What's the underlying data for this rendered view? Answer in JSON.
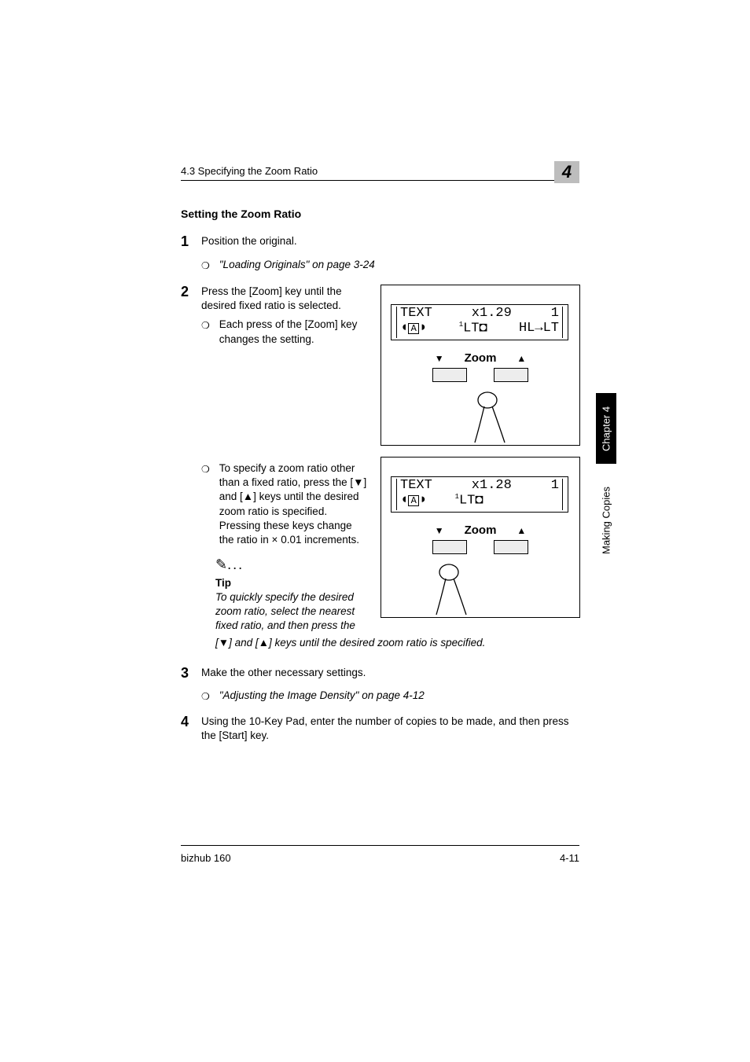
{
  "runningHead": "4.3 Specifying the Zoom Ratio",
  "chapterNum": "4",
  "heading": "Setting the Zoom Ratio",
  "step1": {
    "num": "1",
    "text": "Position the original.",
    "ref": "\"Loading Originals\" on page 3-24"
  },
  "step2": {
    "num": "2",
    "text": "Press the [Zoom] key until the desired fixed ratio is selected.",
    "sub1": "Each press of the [Zoom] key changes the setting.",
    "sub2": "To specify a zoom ratio other than a fixed ratio, press the [▼] and [▲] keys until the desired zoom ratio is specified. Pressing these keys change the ratio in × 0.01 increments.",
    "tipLabel": "Tip",
    "tipBody": "To quickly specify the desired zoom ratio, select the nearest fixed ratio, and then press the",
    "tipCont": "[▼] and [▲] keys until the desired zoom ratio is specified."
  },
  "step3": {
    "num": "3",
    "text": "Make the other necessary settings.",
    "ref": "\"Adjusting the Image Density\" on page 4-12"
  },
  "step4": {
    "num": "4",
    "text": "Using the 10-Key Pad, enter the number of copies to be made, and then press the [Start] key."
  },
  "lcd1": {
    "l1a": "TEXT",
    "l1b": "x1.29",
    "l1c": "1",
    "l2b": "LT",
    "l2c": "HL→LT"
  },
  "lcd2": {
    "l1a": "TEXT",
    "l1b": "x1.28",
    "l1c": "1",
    "l2b": "LT"
  },
  "zoomLabel": "Zoom",
  "sideTab1": "Chapter 4",
  "sideTab2": "Making Copies",
  "footerLeft": "bizhub 160",
  "footerRight": "4-11"
}
